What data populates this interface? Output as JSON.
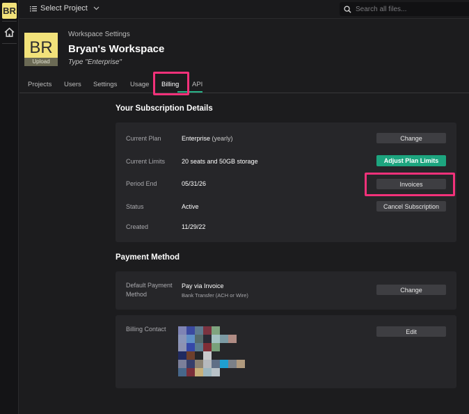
{
  "rail": {
    "badge": "BR"
  },
  "topbar": {
    "select_project": "Select Project",
    "search_placeholder": "Search all files..."
  },
  "header": {
    "avatar_initials": "BR",
    "upload_label": "Upload",
    "settings_label": "Workspace Settings",
    "workspace_name": "Bryan's Workspace",
    "workspace_type": "Type \"Enterprise\""
  },
  "tabs": [
    {
      "label": "Projects"
    },
    {
      "label": "Users"
    },
    {
      "label": "Settings"
    },
    {
      "label": "Usage"
    },
    {
      "label": "Billing",
      "active": true
    },
    {
      "label": "API"
    }
  ],
  "subscription": {
    "title": "Your Subscription Details",
    "rows": [
      {
        "label": "Current Plan",
        "value": "Enterprise",
        "value_extra": "(yearly)",
        "button": "Change"
      },
      {
        "label": "Current Limits",
        "value": "20 seats and 50GB storage",
        "button": "Adjust Plan Limits"
      },
      {
        "label": "Period End",
        "value": "05/31/26",
        "button": "Invoices"
      },
      {
        "label": "Status",
        "value": "Active",
        "button": "Cancel Subscription"
      },
      {
        "label": "Created",
        "value": "11/29/22"
      }
    ]
  },
  "payment": {
    "title": "Payment Method",
    "default_label_line1": "Default Payment",
    "default_label_line2": "Method",
    "method": "Pay via Invoice",
    "method_detail": "Bank Transfer (ACH or Wire)",
    "change_button": "Change",
    "contact_label": "Billing Contact",
    "edit_button": "Edit"
  },
  "colors": {
    "accent": "#29b388",
    "primary_button": "#1da57f",
    "highlight": "#f2317a",
    "avatar": "#f2e27a"
  }
}
